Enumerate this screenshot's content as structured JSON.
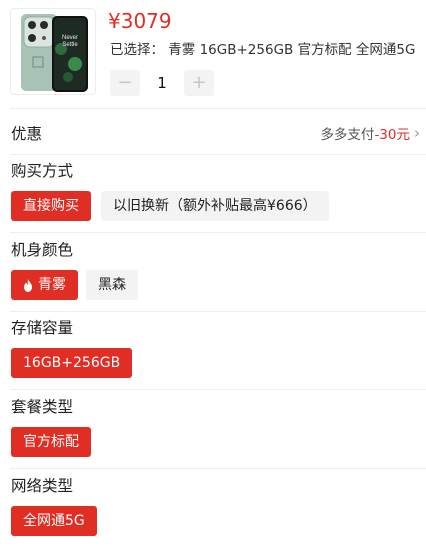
{
  "product": {
    "price": "¥3079",
    "selected_label": "已选择：",
    "selected_value": "青雾 16GB+256GB 官方标配 全网通5G",
    "quantity": "1",
    "minus_symbol": "−",
    "plus_symbol": "+"
  },
  "promo": {
    "title": "优惠",
    "text": "多多支付",
    "amount": "-30元",
    "chevron": "›"
  },
  "purchase": {
    "title": "购买方式",
    "options": [
      "直接购买",
      "以旧换新（额外补贴最高¥666）"
    ],
    "selected_index": 0
  },
  "color": {
    "title": "机身颜色",
    "options": [
      "青雾",
      "黑森"
    ],
    "selected_index": 0,
    "hot_icon": "flame-icon"
  },
  "storage": {
    "title": "存储容量",
    "options": [
      "16GB+256GB"
    ],
    "selected_index": 0
  },
  "package": {
    "title": "套餐类型",
    "options": [
      "官方标配"
    ],
    "selected_index": 0
  },
  "network": {
    "title": "网络类型",
    "options": [
      "全网通5G"
    ],
    "selected_index": 0
  },
  "colors": {
    "accent": "#e02e24",
    "chip_bg": "#f3f3f3",
    "phone_body": "#9fb9ad"
  }
}
